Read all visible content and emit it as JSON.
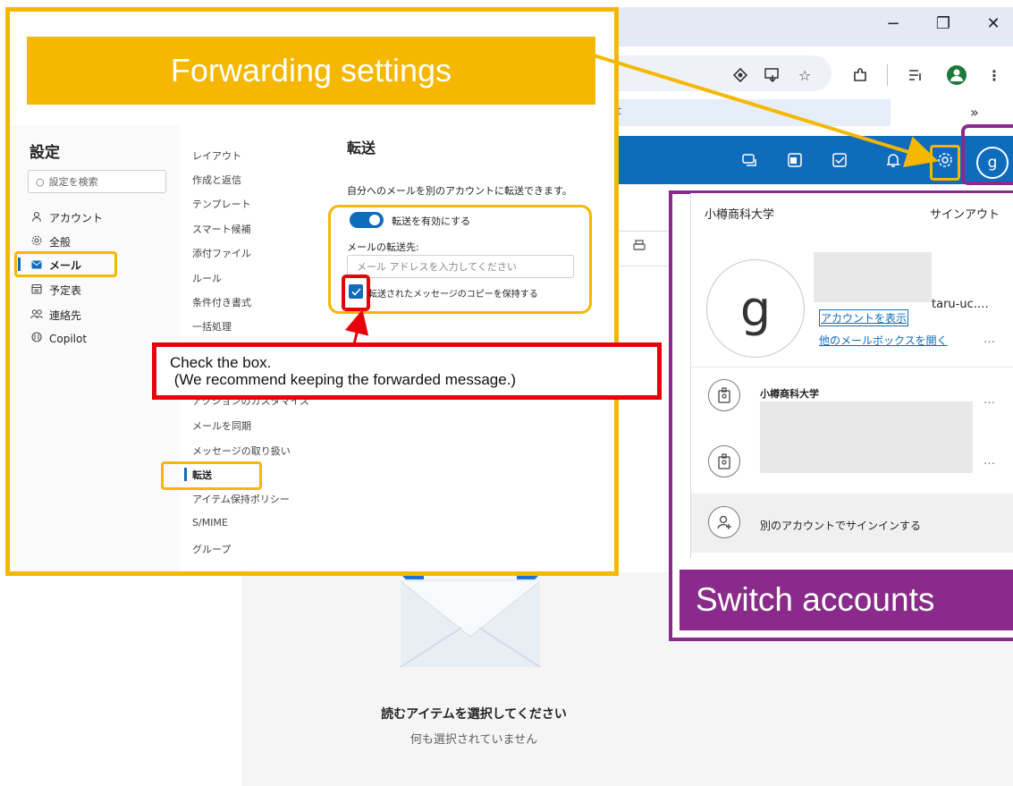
{
  "browser": {
    "window_controls": {
      "minimize": "−",
      "restore": "❐",
      "close": "✕"
    },
    "toolbar_icons": [
      "extension-icon",
      "cast-icon",
      "star-icon",
      "puzzle-icon",
      "reading-list-icon",
      "profile-icon",
      "menu-icon"
    ],
    "bookmark_text": "t",
    "bookmark_more": "»"
  },
  "outlook": {
    "header_icons": [
      "teams-icon",
      "word-icon",
      "todo-icon",
      "bell-icon",
      "gear-icon"
    ],
    "account_initial": "g",
    "reading_pane": {
      "title": "読むアイテムを選択してください",
      "subtitle": "何も選択されていません"
    }
  },
  "account_switcher": {
    "org_name": "小樽商科大学",
    "sign_out": "サインアウト",
    "avatar_initial": "g",
    "email_fragment": "taru-uc.",
    "dots": "…",
    "view_account": "アカウントを表示",
    "open_other_mailbox": "他のメールボックスを開く",
    "other_account_org": "小樽商科大学",
    "sign_in_other": "別のアカウントでサインインする",
    "banner": "Switch accounts"
  },
  "settings": {
    "banner": "Forwarding settings",
    "title": "設定",
    "search_placeholder": "設定を検索",
    "nav": [
      {
        "label": "アカウント",
        "icon": "person-icon"
      },
      {
        "label": "全般",
        "icon": "gear-icon"
      },
      {
        "label": "メール",
        "icon": "mail-icon"
      },
      {
        "label": "予定表",
        "icon": "calendar-icon"
      },
      {
        "label": "連絡先",
        "icon": "people-icon"
      },
      {
        "label": "Copilot",
        "icon": "copilot-icon"
      }
    ],
    "sub_items": [
      "レイアウト",
      "作成と返信",
      "テンプレート",
      "スマート候補",
      "添付ファイル",
      "ルール",
      "条件付き書式",
      "一括処理",
      "アクションのカスタマイズ",
      "メールを同期",
      "メッセージの取り扱い",
      "転送",
      "アイテム保持ポリシー",
      "S/MIME",
      "グループ"
    ],
    "forwarding": {
      "title": "転送",
      "description": "自分へのメールを別のアカウントに転送できます。",
      "enable_label": "転送を有効にする",
      "enabled": true,
      "forward_to_label": "メールの転送先:",
      "forward_to_placeholder": "メール アドレスを入力してください",
      "keep_copy_label": "転送されたメッセージのコピーを保持する",
      "keep_copy_checked": true
    },
    "callout_line1": "Check the box.",
    "callout_line2": " (We recommend keeping the forwarded message.)"
  },
  "colors": {
    "highlight_yellow": "#f5b700",
    "highlight_purple": "#8a2a8a",
    "highlight_red": "#e8000a",
    "outlook_blue": "#0f6cbd"
  }
}
